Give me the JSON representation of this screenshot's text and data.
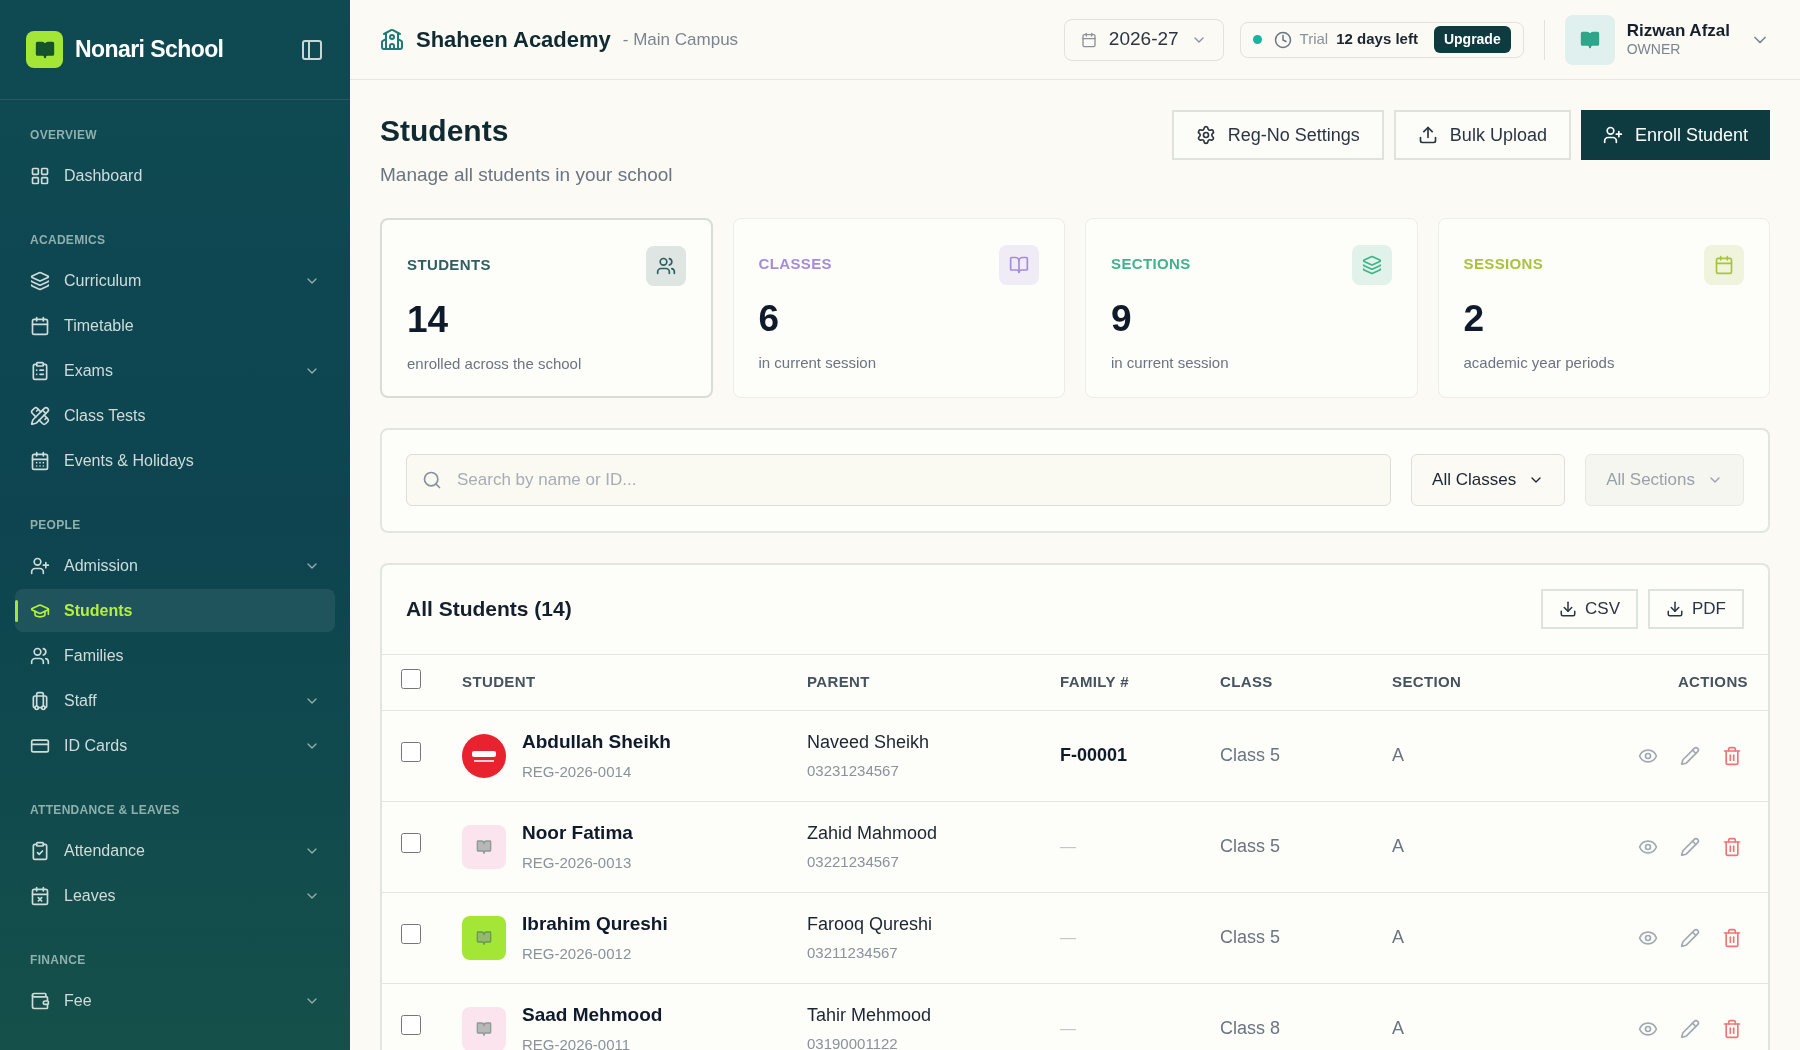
{
  "brand": {
    "name": "Nonari School"
  },
  "sidebar": {
    "sections": [
      {
        "label": "OVERVIEW",
        "items": [
          {
            "label": "Dashboard",
            "expandable": false,
            "selected": false
          }
        ]
      },
      {
        "label": "ACADEMICS",
        "items": [
          {
            "label": "Curriculum",
            "expandable": true,
            "selected": false
          },
          {
            "label": "Timetable",
            "expandable": false,
            "selected": false
          },
          {
            "label": "Exams",
            "expandable": true,
            "selected": false
          },
          {
            "label": "Class Tests",
            "expandable": false,
            "selected": false
          },
          {
            "label": "Events & Holidays",
            "expandable": false,
            "selected": false
          }
        ]
      },
      {
        "label": "PEOPLE",
        "items": [
          {
            "label": "Admission",
            "expandable": true,
            "selected": false
          },
          {
            "label": "Students",
            "expandable": false,
            "selected": true
          },
          {
            "label": "Families",
            "expandable": false,
            "selected": false
          },
          {
            "label": "Staff",
            "expandable": true,
            "selected": false
          },
          {
            "label": "ID Cards",
            "expandable": true,
            "selected": false
          }
        ]
      },
      {
        "label": "ATTENDANCE & LEAVES",
        "items": [
          {
            "label": "Attendance",
            "expandable": true,
            "selected": false
          },
          {
            "label": "Leaves",
            "expandable": true,
            "selected": false
          }
        ]
      },
      {
        "label": "FINANCE",
        "items": [
          {
            "label": "Fee",
            "expandable": true,
            "selected": false
          }
        ]
      }
    ]
  },
  "header": {
    "school": "Shaheen Academy",
    "campus": "- Main Campus",
    "session": "2026-27",
    "trial_label": "Trial",
    "trial_days": "12 days left",
    "upgrade": "Upgrade",
    "user_name": "Rizwan Afzal",
    "user_role": "OWNER"
  },
  "page": {
    "title": "Students",
    "subtitle": "Manage all students in your school",
    "actions": [
      {
        "label": "Reg-No Settings",
        "kind": "outline"
      },
      {
        "label": "Bulk Upload",
        "kind": "outline"
      },
      {
        "label": "Enroll Student",
        "kind": "primary"
      }
    ]
  },
  "stats": [
    {
      "label": "STUDENTS",
      "value": "14",
      "caption": "enrolled across the school",
      "color": "#2f5f5f"
    },
    {
      "label": "CLASSES",
      "value": "6",
      "caption": "in current session",
      "color": "#a78bdb"
    },
    {
      "label": "SECTIONS",
      "value": "9",
      "caption": "in current session",
      "color": "#3fb38c"
    },
    {
      "label": "SESSIONS",
      "value": "2",
      "caption": "academic year periods",
      "color": "#a8c43c"
    }
  ],
  "filters": {
    "search": {
      "placeholder": "Search by name or ID..."
    },
    "class_select": "All Classes",
    "section_select": "All Sections",
    "section_disabled": true
  },
  "table": {
    "title": "All Students (14)",
    "select_all_checked": false,
    "exports": [
      "CSV",
      "PDF"
    ],
    "columns": [
      "STUDENT",
      "PARENT",
      "FAMILY #",
      "CLASS",
      "SECTION",
      "ACTIONS"
    ],
    "rows": [
      {
        "checked": false,
        "name": "Abdullah Sheikh",
        "reg": "REG-2026-0014",
        "parent": "Naveed Sheikh",
        "phone": "03231234567",
        "family": "F-00001",
        "class": "Class 5",
        "section": "A"
      },
      {
        "checked": false,
        "avatar": {
          "kind": "placeholder",
          "color": "#fce4ee"
        },
        "name": "Noor Fatima",
        "reg": "REG-2026-0013",
        "parent": "Zahid Mahmood",
        "phone": "03221234567",
        "family": "—",
        "class": "Class 5",
        "section": "A"
      },
      {
        "checked": false,
        "avatar": {
          "kind": "placeholder",
          "color": "#a3e635"
        },
        "name": "Ibrahim Qureshi",
        "reg": "REG-2026-0012",
        "parent": "Farooq Qureshi",
        "phone": "03211234567",
        "family": "—",
        "class": "Class 5",
        "section": "A"
      },
      {
        "checked": false,
        "avatar": {
          "kind": "placeholder",
          "color": "#fce4ee"
        },
        "name": "Saad Mehmood",
        "reg": "REG-2026-0011",
        "parent": "Tahir Mehmood",
        "phone": "03190001122",
        "family": "—",
        "class": "Class 8",
        "section": "A"
      }
    ]
  }
}
